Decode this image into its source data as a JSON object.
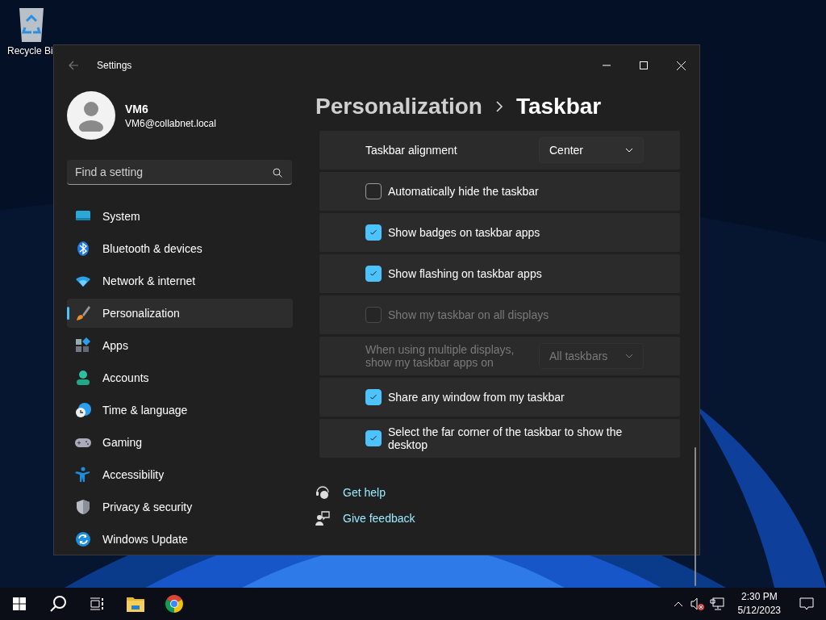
{
  "desktop": {
    "icons": [
      {
        "label": "Recycle Bi"
      }
    ]
  },
  "window": {
    "title": "Settings",
    "user": {
      "name": "VM6",
      "email": "VM6@collabnet.local"
    },
    "search": {
      "placeholder": "Find a setting"
    },
    "nav": [
      {
        "label": "System",
        "selected": false
      },
      {
        "label": "Bluetooth & devices",
        "selected": false
      },
      {
        "label": "Network & internet",
        "selected": false
      },
      {
        "label": "Personalization",
        "selected": true
      },
      {
        "label": "Apps",
        "selected": false
      },
      {
        "label": "Accounts",
        "selected": false
      },
      {
        "label": "Time & language",
        "selected": false
      },
      {
        "label": "Gaming",
        "selected": false
      },
      {
        "label": "Accessibility",
        "selected": false
      },
      {
        "label": "Privacy & security",
        "selected": false
      },
      {
        "label": "Windows Update",
        "selected": false
      }
    ],
    "breadcrumb": [
      "Personalization",
      "Taskbar"
    ],
    "settings": [
      {
        "kind": "dropdown",
        "label": "Taskbar alignment",
        "value": "Center",
        "disabled": false
      },
      {
        "kind": "checkbox",
        "label": "Automatically hide the taskbar",
        "checked": false,
        "disabled": false
      },
      {
        "kind": "checkbox",
        "label": "Show badges on taskbar apps",
        "checked": true,
        "disabled": false
      },
      {
        "kind": "checkbox",
        "label": "Show flashing on taskbar apps",
        "checked": true,
        "disabled": false
      },
      {
        "kind": "checkbox",
        "label": "Show my taskbar on all displays",
        "checked": false,
        "disabled": true
      },
      {
        "kind": "dropdown",
        "label": "When using multiple displays, show my taskbar apps on",
        "value": "All taskbars",
        "disabled": true
      },
      {
        "kind": "checkbox",
        "label": "Share any window from my taskbar",
        "checked": true,
        "disabled": false
      },
      {
        "kind": "checkbox",
        "label": "Select the far corner of the taskbar to show the desktop",
        "checked": true,
        "disabled": false
      }
    ],
    "links": [
      {
        "label": "Get help"
      },
      {
        "label": "Give feedback"
      }
    ]
  },
  "taskbar": {
    "time": "2:30 PM",
    "date": "5/12/2023"
  }
}
